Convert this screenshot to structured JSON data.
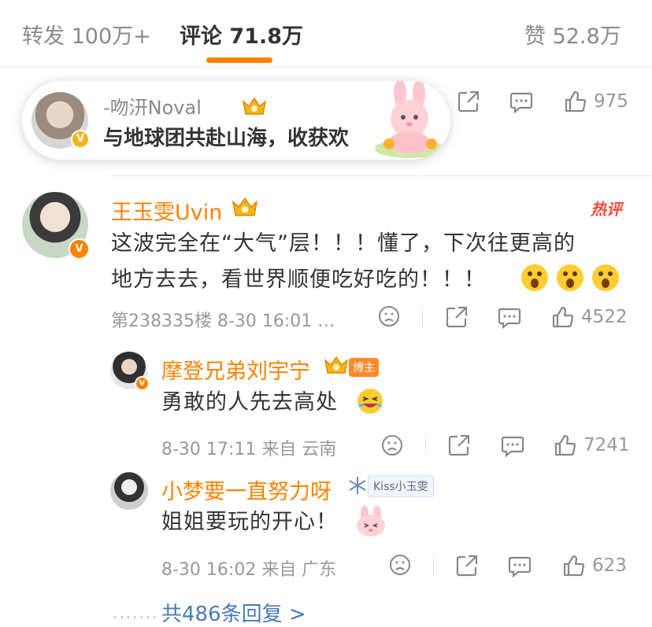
{
  "tabs": {
    "repost": "转发 100万+",
    "comments": "评论 71.8万",
    "likes": "赞 52.8万"
  },
  "popup": {
    "name": "-吻汧Noval",
    "text": "与地球团共赴山海，收获欢"
  },
  "top_row": {
    "like_count": "975"
  },
  "comment": {
    "name": "王玉雯Uvin",
    "hot_label": "热评",
    "text_line1": "这波完全在“大气”层！！！懂了，下次往更高的",
    "text_line2": "地方去去，看世界顺便吃好吃的！！！",
    "meta": "第238335楼 8-30 16:01 …",
    "like_count": "4522"
  },
  "reply1": {
    "name": "摩登兄弟刘宇宁",
    "badge": "博主",
    "text": "勇敢的人先去高处",
    "meta": "8-30 17:11 来自 云南",
    "like_count": "7241"
  },
  "reply2": {
    "name": "小梦要一直努力呀",
    "fan_tag": "Kiss小玉雯",
    "text": "姐姐要玩的开心！",
    "meta": "8-30 16:02 来自 广东",
    "like_count": "623"
  },
  "more_replies": "共486条回复 >",
  "colors": {
    "accent": "#ff8200",
    "link": "#4a7bb7",
    "hot": "#ff4a3d"
  }
}
